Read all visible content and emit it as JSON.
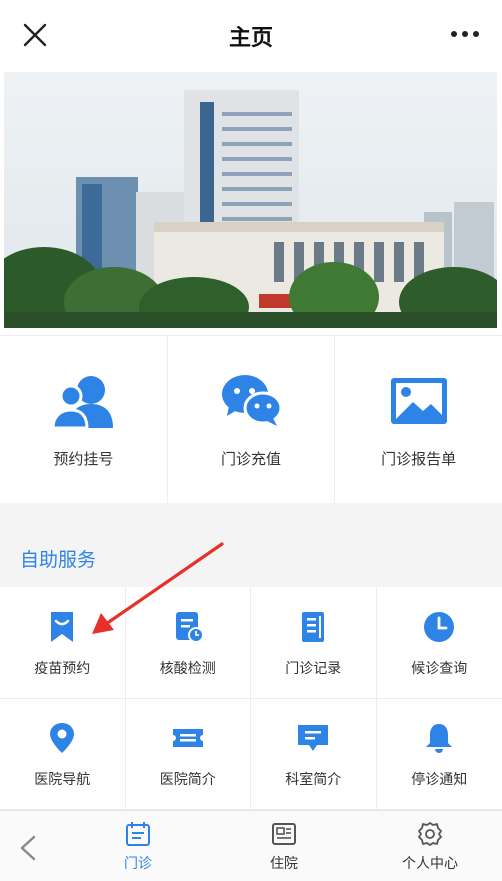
{
  "header": {
    "title": "主页"
  },
  "quick_actions": [
    {
      "label": "预约挂号",
      "icon": "users-icon"
    },
    {
      "label": "门诊充值",
      "icon": "wechat-icon"
    },
    {
      "label": "门诊报告单",
      "icon": "image-icon"
    }
  ],
  "self_service": {
    "title": "自助服务",
    "items": [
      {
        "label": "疫苗预约",
        "icon": "bookmark-icon"
      },
      {
        "label": "核酸检测",
        "icon": "clock-document-icon"
      },
      {
        "label": "门诊记录",
        "icon": "document-icon"
      },
      {
        "label": "候诊查询",
        "icon": "clock-icon"
      },
      {
        "label": "医院导航",
        "icon": "location-pin-icon"
      },
      {
        "label": "医院简介",
        "icon": "ticket-icon"
      },
      {
        "label": "科室简介",
        "icon": "message-icon"
      },
      {
        "label": "停诊通知",
        "icon": "bell-icon"
      }
    ]
  },
  "tabbar": {
    "tabs": [
      {
        "label": "门诊",
        "active": true,
        "icon": "calendar-icon"
      },
      {
        "label": "住院",
        "active": false,
        "icon": "newspaper-icon"
      },
      {
        "label": "个人中心",
        "active": false,
        "icon": "gear-icon"
      }
    ]
  },
  "colors": {
    "accent": "#2e84e6",
    "arrow": "#e8302a",
    "section_bg": "#f4f4f4"
  }
}
